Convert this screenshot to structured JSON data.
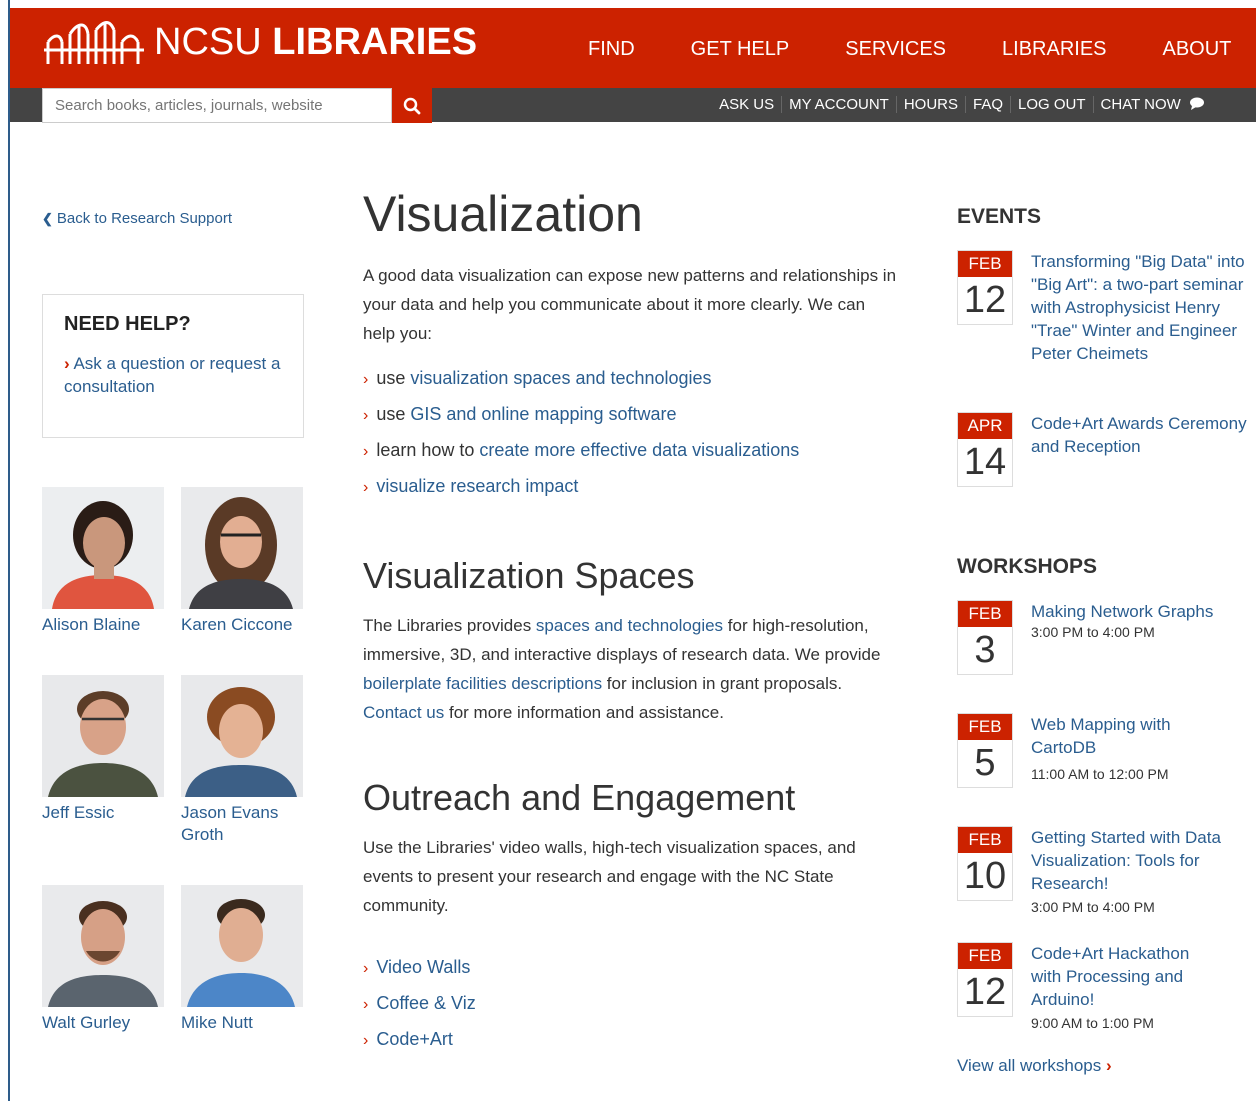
{
  "brand": {
    "name_light": "NCSU",
    "name_bold": "LIBRARIES",
    "primary_color": "#cc2200",
    "link_color": "#2a5d8f"
  },
  "main_nav": [
    "FIND",
    "GET HELP",
    "SERVICES",
    "LIBRARIES",
    "ABOUT"
  ],
  "search": {
    "placeholder": "Search books, articles, journals, website"
  },
  "utility_nav": [
    "ASK US",
    "MY ACCOUNT",
    "HOURS",
    "FAQ",
    "LOG OUT",
    "CHAT NOW"
  ],
  "sidebar": {
    "back_link": "Back to Research Support",
    "help": {
      "title": "NEED HELP?",
      "link": "Ask a question or request a consultation"
    },
    "staff": [
      "Alison Blaine",
      "Karen Ciccone",
      "Jeff Essic",
      "Jason Evans Groth",
      "Walt Gurley",
      "Mike Nutt"
    ]
  },
  "main": {
    "title": "Visualization",
    "intro": "A good data visualization can expose new patterns and relationships in your data and help you communicate about it more clearly. We can help you:",
    "bullets": [
      {
        "prefix": "use ",
        "link": "visualization spaces and technologies",
        "suffix": ""
      },
      {
        "prefix": "use ",
        "link": "GIS and online mapping software",
        "suffix": ""
      },
      {
        "prefix": "learn how to ",
        "link": "create more effective data visualizations",
        "suffix": ""
      },
      {
        "prefix": "",
        "link": "visualize research impact",
        "suffix": ""
      }
    ],
    "spaces": {
      "title": "Visualization Spaces",
      "p1": "The Libraries provides ",
      "l1": "spaces and technologies",
      "p2": " for high-resolution, immersive, 3D, and interactive displays of research data. We provide ",
      "l2": "boilerplate facilities descriptions",
      "p3": " for inclusion in grant proposals. ",
      "l3": "Contact us",
      "p4": " for more information and assistance."
    },
    "outreach": {
      "title": "Outreach and Engagement",
      "text": "Use the Libraries' video walls, high-tech visualization spaces, and events to present your research and engage with the NC State community.",
      "links": [
        "Video Walls",
        "Coffee & Viz",
        "Code+Art"
      ]
    }
  },
  "events": {
    "title": "EVENTS",
    "items": [
      {
        "month": "FEB",
        "day": "12",
        "title": "Transforming \"Big Data\" into \"Big Art\": a two-part seminar with Astrophysicist Henry \"Trae\" Winter and Engineer Peter Cheimets"
      },
      {
        "month": "APR",
        "day": "14",
        "title": "Code+Art Awards Ceremony and Reception"
      }
    ]
  },
  "workshops": {
    "title": "WORKSHOPS",
    "items": [
      {
        "month": "FEB",
        "day": "3",
        "title": "Making Network Graphs",
        "time": "3:00 PM to 4:00 PM"
      },
      {
        "month": "FEB",
        "day": "5",
        "title": "Web Mapping with CartoDB",
        "time": "11:00 AM to 12:00 PM"
      },
      {
        "month": "FEB",
        "day": "10",
        "title": "Getting Started with Data Visualization: Tools for Research!",
        "time": "3:00 PM to 4:00 PM"
      },
      {
        "month": "FEB",
        "day": "12",
        "title": "Code+Art Hackathon with Processing and Arduino!",
        "time": "9:00 AM to 1:00 PM"
      }
    ],
    "view_all": "View all workshops"
  }
}
